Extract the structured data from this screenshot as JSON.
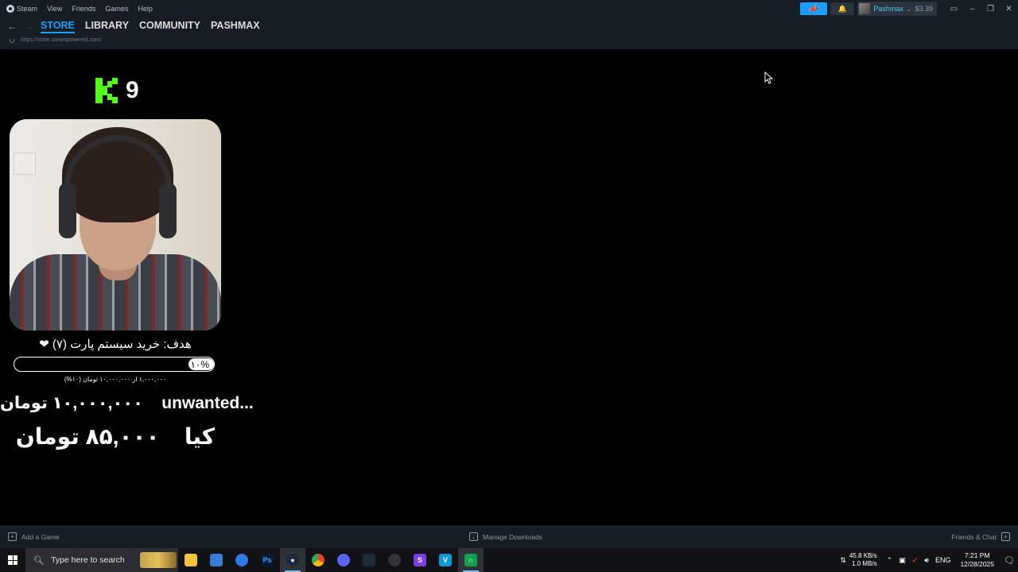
{
  "menubar": {
    "app_name": "Steam",
    "items": [
      "View",
      "Friends",
      "Games",
      "Help"
    ],
    "account_name": "Pashmax",
    "balance": "$3.39"
  },
  "nav": {
    "tabs": [
      "STORE",
      "LIBRARY",
      "COMMUNITY",
      "PASHMAX"
    ],
    "active_tab": "STORE",
    "url": "https://store.steampowered.com/"
  },
  "overlay": {
    "kick_viewers": "9",
    "goal_text": "هدف: خرید سیستم پارت (۷) ❤",
    "progress_percent": 10,
    "progress_label": "۱۰%",
    "progress_sub": "۱,۰۰۰,۰۰۰ از ۱۰,۰۰۰,۰۰۰ تومان (۱۰%)",
    "donor1_name": "unwanted...",
    "donor1_amount": "۱۰,۰۰۰,۰۰۰ تومان",
    "donor2_name": "کیا",
    "donor2_amount": "۸۵,۰۰۰ تومان"
  },
  "bottombar": {
    "add_game": "Add a Game",
    "manage_downloads": "Manage Downloads",
    "friends_chat": "Friends & Chat"
  },
  "taskbar": {
    "search_placeholder": "Type here to search",
    "net_down": "45.8 KB/s",
    "net_up": "1.0 MB/s",
    "lang": "ENG",
    "time": "7:21 PM",
    "date": "12/28/2025"
  },
  "colors": {
    "steam_bg": "#171d25",
    "accent": "#1a9fff",
    "kick_green": "#53fc18"
  }
}
